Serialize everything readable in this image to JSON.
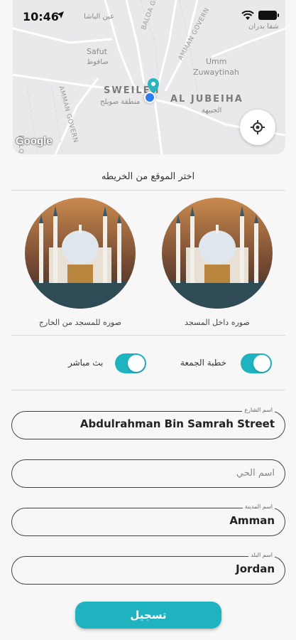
{
  "status": {
    "time": "10:46"
  },
  "map": {
    "labels": {
      "top_ar": "عين الباشا",
      "safut": "Safut",
      "safut_ar": "صافوط",
      "sweileh": "SWEILEH",
      "sweileh_ar": "منطقة صويلح",
      "jubeiha": "AL JUBEIHA",
      "jubeiha_ar": "الجبيهة",
      "umm": "Umm",
      "zuwaytinah": "Zuwaytinah",
      "road_baloa_gov_top": "BALOA GOVER",
      "road_amman_gov_top": "AMMAN GOVERN",
      "road_baloa_gov_left": "BALQA GOVERN",
      "road_amman_gov_left": "AMMAN GOVERN",
      "topright_ar": "شفا بدران",
      "google": "Google"
    },
    "icons": {
      "locate": "my-location-icon",
      "pin": "location-pin-icon"
    }
  },
  "pick_location_label": "اختر الموقع من الخريطه",
  "photos": {
    "inside_caption": "صوره داخل المسجد",
    "outside_caption": "صوره للمسجد من الخارج"
  },
  "toggles": {
    "friday_sermon": {
      "label": "خطبة الجمعة",
      "on": true
    },
    "live_stream": {
      "label": "بث مباشر",
      "on": true
    }
  },
  "fields": {
    "street": {
      "tag": "اسم الشارع",
      "value": "Abdulrahman Bin Samrah Street"
    },
    "district": {
      "placeholder": "اسم الحي",
      "value": ""
    },
    "city": {
      "tag": "اسم المدينة",
      "value": "Amman"
    },
    "country": {
      "tag": "اسم البلد",
      "value": "Jordan"
    }
  },
  "submit_label": "تسجيل",
  "colors": {
    "accent": "#1fb3c0",
    "location_dot": "#2f7cf6"
  }
}
